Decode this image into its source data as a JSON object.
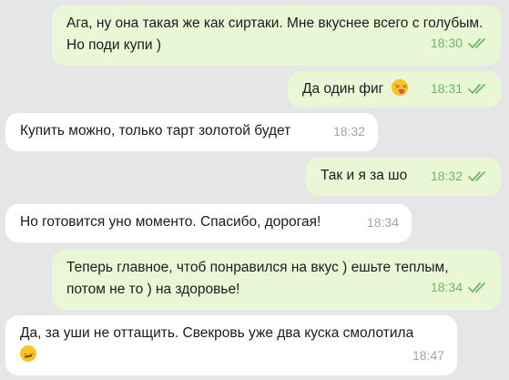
{
  "colors": {
    "background": "#e6e6e6",
    "outgoing_bubble": "#eaf7d6",
    "incoming_bubble": "#ffffff",
    "outgoing_meta": "#6fb46a",
    "incoming_meta": "#a5a5a5"
  },
  "messages": [
    {
      "direction": "out",
      "text": "Ага, ну она такая же как сиртаки. Мне вкуснее всего с голубым. Но поди купи )",
      "time": "18:30",
      "status": "double-check-icon"
    },
    {
      "direction": "out",
      "text": "Да один фиг",
      "emoji": "squinting-tongue-emoji",
      "time": "18:31",
      "status": "double-check-icon"
    },
    {
      "direction": "in",
      "text": "Купить можно, только тарт золотой будет",
      "time": "18:32"
    },
    {
      "direction": "out",
      "text": "Так и я за шо",
      "time": "18:32",
      "status": "double-check-icon"
    },
    {
      "direction": "in",
      "text": "Но готовится уно моменто. Спасибо, дорогая!",
      "time": "18:34"
    },
    {
      "direction": "out",
      "text": "Теперь главное, чтоб понравился на вкус ) ешьте теплым, потом не то ) на здоровье!",
      "time": "18:34",
      "status": "double-check-icon"
    },
    {
      "direction": "in",
      "text": "Да, за уши не оттащить. Свекровь уже два куска смолотила",
      "emoji": "smirking-face-emoji",
      "time": "18:47"
    }
  ]
}
